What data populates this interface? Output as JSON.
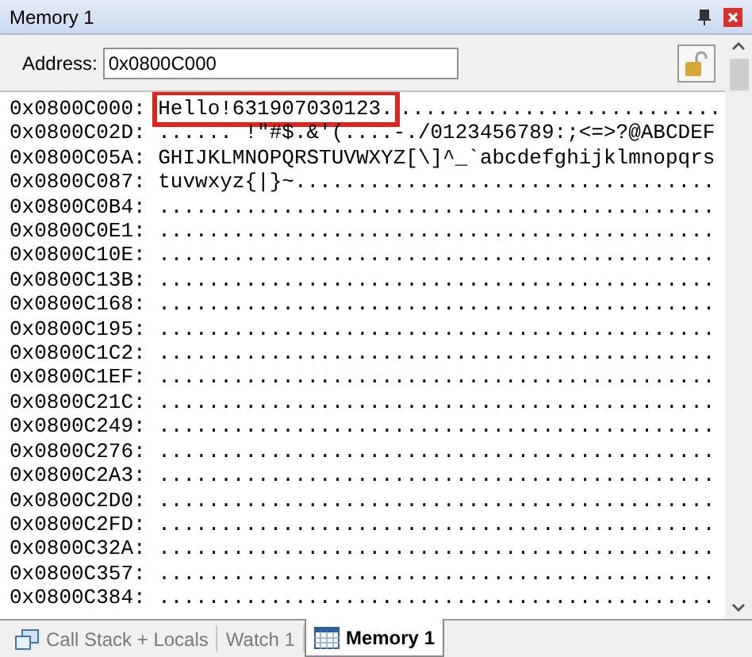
{
  "window": {
    "title": "Memory 1"
  },
  "address": {
    "label": "Address:",
    "value": "0x0800C000"
  },
  "rows": [
    {
      "address": "0x0800C000:",
      "segments": [
        {
          "text": "Hello!631907030123.",
          "highlighted": true
        },
        {
          "text": "..........................",
          "highlighted": false
        }
      ]
    },
    {
      "address": "0x0800C02D:",
      "segments": [
        {
          "text": "...... !\"#$.&'(....-./0123456789:;<=>?@ABCDEF",
          "highlighted": false
        }
      ]
    },
    {
      "address": "0x0800C05A:",
      "segments": [
        {
          "text": "GHIJKLMNOPQRSTUVWXYZ[\\]^_`abcdefghijklmnopqrs",
          "highlighted": false
        }
      ]
    },
    {
      "address": "0x0800C087:",
      "segments": [
        {
          "text": "tuvwxyz{|}~..................................",
          "highlighted": false
        }
      ]
    },
    {
      "address": "0x0800C0B4:",
      "segments": [
        {
          "text": ".............................................",
          "highlighted": false
        }
      ]
    },
    {
      "address": "0x0800C0E1:",
      "segments": [
        {
          "text": ".............................................",
          "highlighted": false
        }
      ]
    },
    {
      "address": "0x0800C10E:",
      "segments": [
        {
          "text": ".............................................",
          "highlighted": false
        }
      ]
    },
    {
      "address": "0x0800C13B:",
      "segments": [
        {
          "text": ".............................................",
          "highlighted": false
        }
      ]
    },
    {
      "address": "0x0800C168:",
      "segments": [
        {
          "text": ".............................................",
          "highlighted": false
        }
      ]
    },
    {
      "address": "0x0800C195:",
      "segments": [
        {
          "text": ".............................................",
          "highlighted": false
        }
      ]
    },
    {
      "address": "0x0800C1C2:",
      "segments": [
        {
          "text": ".............................................",
          "highlighted": false
        }
      ]
    },
    {
      "address": "0x0800C1EF:",
      "segments": [
        {
          "text": ".............................................",
          "highlighted": false
        }
      ]
    },
    {
      "address": "0x0800C21C:",
      "segments": [
        {
          "text": ".............................................",
          "highlighted": false
        }
      ]
    },
    {
      "address": "0x0800C249:",
      "segments": [
        {
          "text": ".............................................",
          "highlighted": false
        }
      ]
    },
    {
      "address": "0x0800C276:",
      "segments": [
        {
          "text": ".............................................",
          "highlighted": false
        }
      ]
    },
    {
      "address": "0x0800C2A3:",
      "segments": [
        {
          "text": ".............................................",
          "highlighted": false
        }
      ]
    },
    {
      "address": "0x0800C2D0:",
      "segments": [
        {
          "text": ".............................................",
          "highlighted": false
        }
      ]
    },
    {
      "address": "0x0800C2FD:",
      "segments": [
        {
          "text": ".............................................",
          "highlighted": false
        }
      ]
    },
    {
      "address": "0x0800C32A:",
      "segments": [
        {
          "text": ".............................................",
          "highlighted": false
        }
      ]
    },
    {
      "address": "0x0800C357:",
      "segments": [
        {
          "text": ".............................................",
          "highlighted": false
        }
      ]
    },
    {
      "address": "0x0800C384:",
      "segments": [
        {
          "text": ".............................................",
          "highlighted": false
        }
      ]
    }
  ],
  "tabs": [
    {
      "label": "Call Stack + Locals",
      "kind": "callstack",
      "selected": false
    },
    {
      "label": "Watch 1",
      "kind": "plain",
      "selected": false
    },
    {
      "label": "Memory 1",
      "kind": "memory",
      "selected": true
    }
  ]
}
